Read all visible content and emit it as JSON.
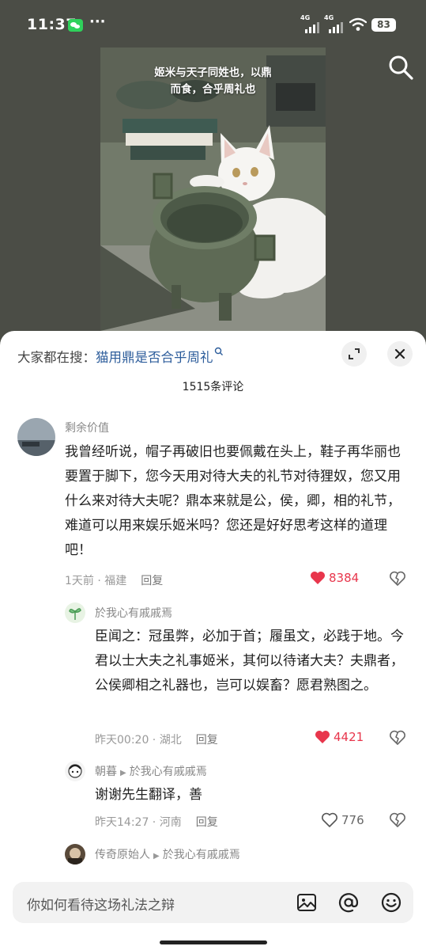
{
  "status_bar": {
    "time": "11:37",
    "network_1": "4G",
    "network_2": "4G",
    "battery": "83"
  },
  "video": {
    "caption_line1": "姬米与天子同姓也，以鼎",
    "caption_line2": "而食，合乎周礼也"
  },
  "sheet": {
    "search_prefix": "大家都在搜：",
    "search_query": "猫用鼎是否合乎周礼",
    "comment_count": "1515条评论"
  },
  "comments": [
    {
      "user": "剩余价值",
      "text": "我曾经听说，帽子再破旧也要佩戴在头上，鞋子再华丽也要置于脚下，您今天用对待大夫的礼节对待狸奴，您又用什么来对待大夫呢？鼎本来就是公，侯，卿，相的礼节，难道可以用来娱乐姬米吗？您还是好好思考这样的道理吧！",
      "time": "1天前",
      "location": "福建",
      "reply_label": "回复",
      "likes": "8384"
    },
    {
      "user": "於我心有戚戚焉",
      "text": "臣闻之：冠虽弊，必加于首；履虽文，必践于地。今君以士大夫之礼事姬米，其何以待诸大夫？夫鼎者，公侯卿相之礼器也，岂可以娱畜？愿君熟图之。",
      "time": "昨天00:20",
      "location": "湖北",
      "reply_label": "回复",
      "likes": "4421"
    },
    {
      "user": "朝暮",
      "reply_to": "於我心有戚戚焉",
      "text": "谢谢先生翻译，善",
      "time": "昨天14:27",
      "location": "河南",
      "reply_label": "回复",
      "likes": "776"
    },
    {
      "user": "传奇原始人",
      "reply_to": "於我心有戚戚焉"
    }
  ],
  "input": {
    "placeholder": "你如何看待这场礼法之辩"
  },
  "colors": {
    "like_active": "#e8364c",
    "link_blue": "#2d5d9b",
    "top_background": "#4b4d46"
  }
}
